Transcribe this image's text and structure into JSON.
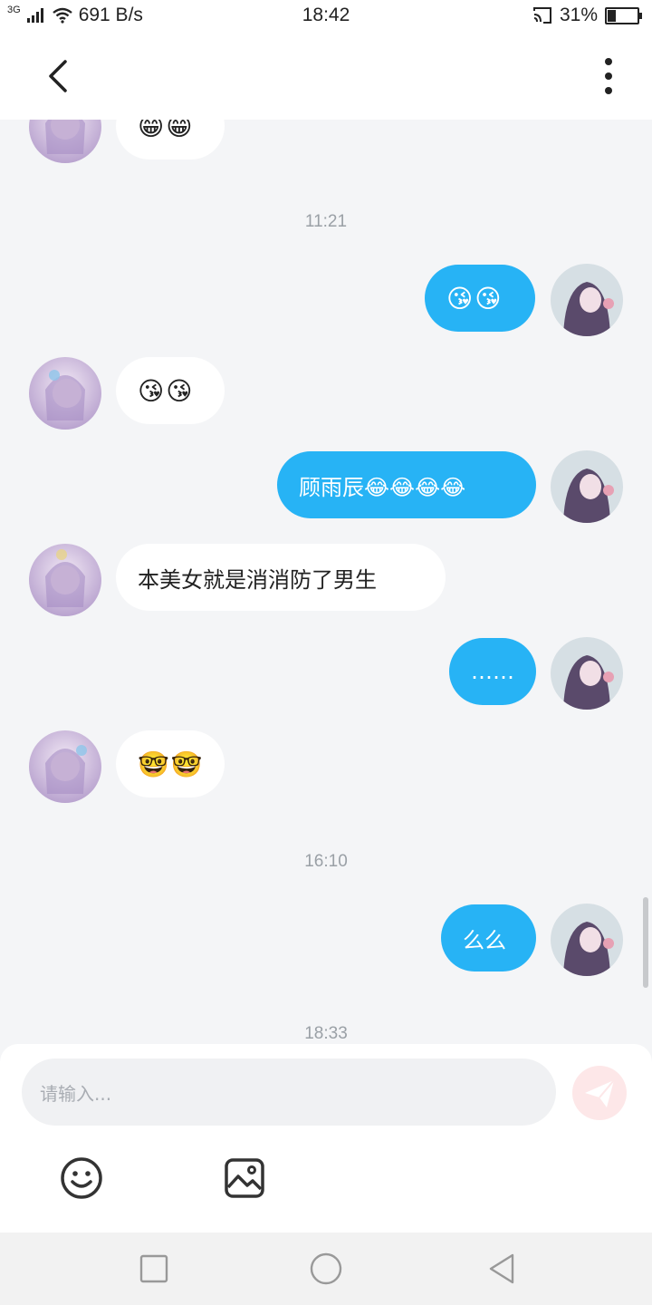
{
  "status_bar": {
    "network": "3G",
    "speed": "691 B/s",
    "time": "18:42",
    "battery_percent": "31%",
    "battery_level": 0.31
  },
  "header": {
    "back_icon": "back-chevron-icon",
    "more_icon": "more-vertical-icon"
  },
  "messages": [
    {
      "side": "in",
      "text": "😁😁"
    },
    {
      "type": "timestamp",
      "text": "11:21"
    },
    {
      "side": "out",
      "text": "😘😘"
    },
    {
      "side": "in",
      "text": "😘😘"
    },
    {
      "side": "out",
      "text": "顾雨辰😂😂😂😂"
    },
    {
      "side": "in",
      "text": "本美女就是消消防了男生"
    },
    {
      "side": "out",
      "text": "……"
    },
    {
      "side": "in",
      "text": "🤓🤓"
    },
    {
      "type": "timestamp",
      "text": "16:10"
    },
    {
      "side": "out",
      "text": "么么"
    },
    {
      "type": "timestamp",
      "text": "18:33"
    }
  ],
  "input": {
    "placeholder": "请输入..."
  },
  "toolbar": {
    "emoji_icon": "smiley-icon",
    "image_icon": "image-icon",
    "send_icon": "send-icon"
  },
  "colors": {
    "outgoing_bubble": "#27b3f5",
    "incoming_bubble": "#ffffff",
    "background": "#f4f5f7",
    "send_button": "#fde7e8"
  }
}
